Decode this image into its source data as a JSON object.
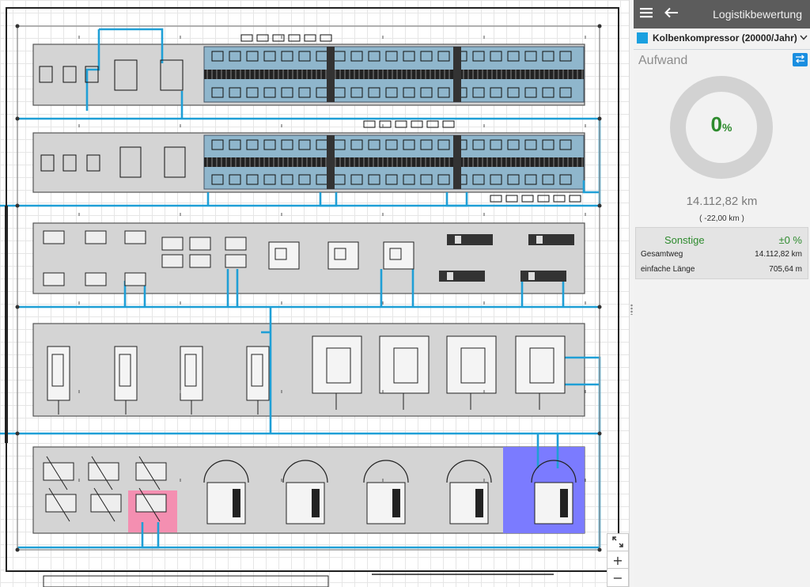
{
  "panel": {
    "title": "Logistikbewertung",
    "product": "Kolbenkompressor (20000/Jahr)",
    "section_title": "Aufwand",
    "donut_percent": "0",
    "donut_unit": "%",
    "donut_fraction": 0,
    "total_distance": "14.112,82 km",
    "distance_delta": "( -22,00 km )",
    "category": {
      "name": "Sonstige",
      "percent": "±0 %",
      "rows": [
        {
          "key": "Gesamtweg",
          "value": "14.112,82 km"
        },
        {
          "key": "einfache Länge",
          "value": "705,64 m"
        }
      ]
    }
  },
  "colors": {
    "header_bg": "#5c5c5c",
    "accent_blue": "#1aa0e0",
    "route_blue": "#1f9fd6",
    "machine_station_fill": "#8fb6cc",
    "highlight_pink": "#f48fb1",
    "highlight_blue": "#7b7bff",
    "success_green": "#2e8b2e",
    "hall_gray": "#d4d4d4"
  },
  "icons": {
    "menu": "hamburger-icon",
    "back": "arrow-left-icon",
    "swap": "swap-arrows-icon",
    "zoom_fit": "expand-arrows-icon",
    "zoom_in": "plus-icon",
    "zoom_out": "minus-icon",
    "dropdown": "chevron-down-icon"
  },
  "zoom": {
    "fit": "⤢",
    "in": "+",
    "out": "−"
  }
}
